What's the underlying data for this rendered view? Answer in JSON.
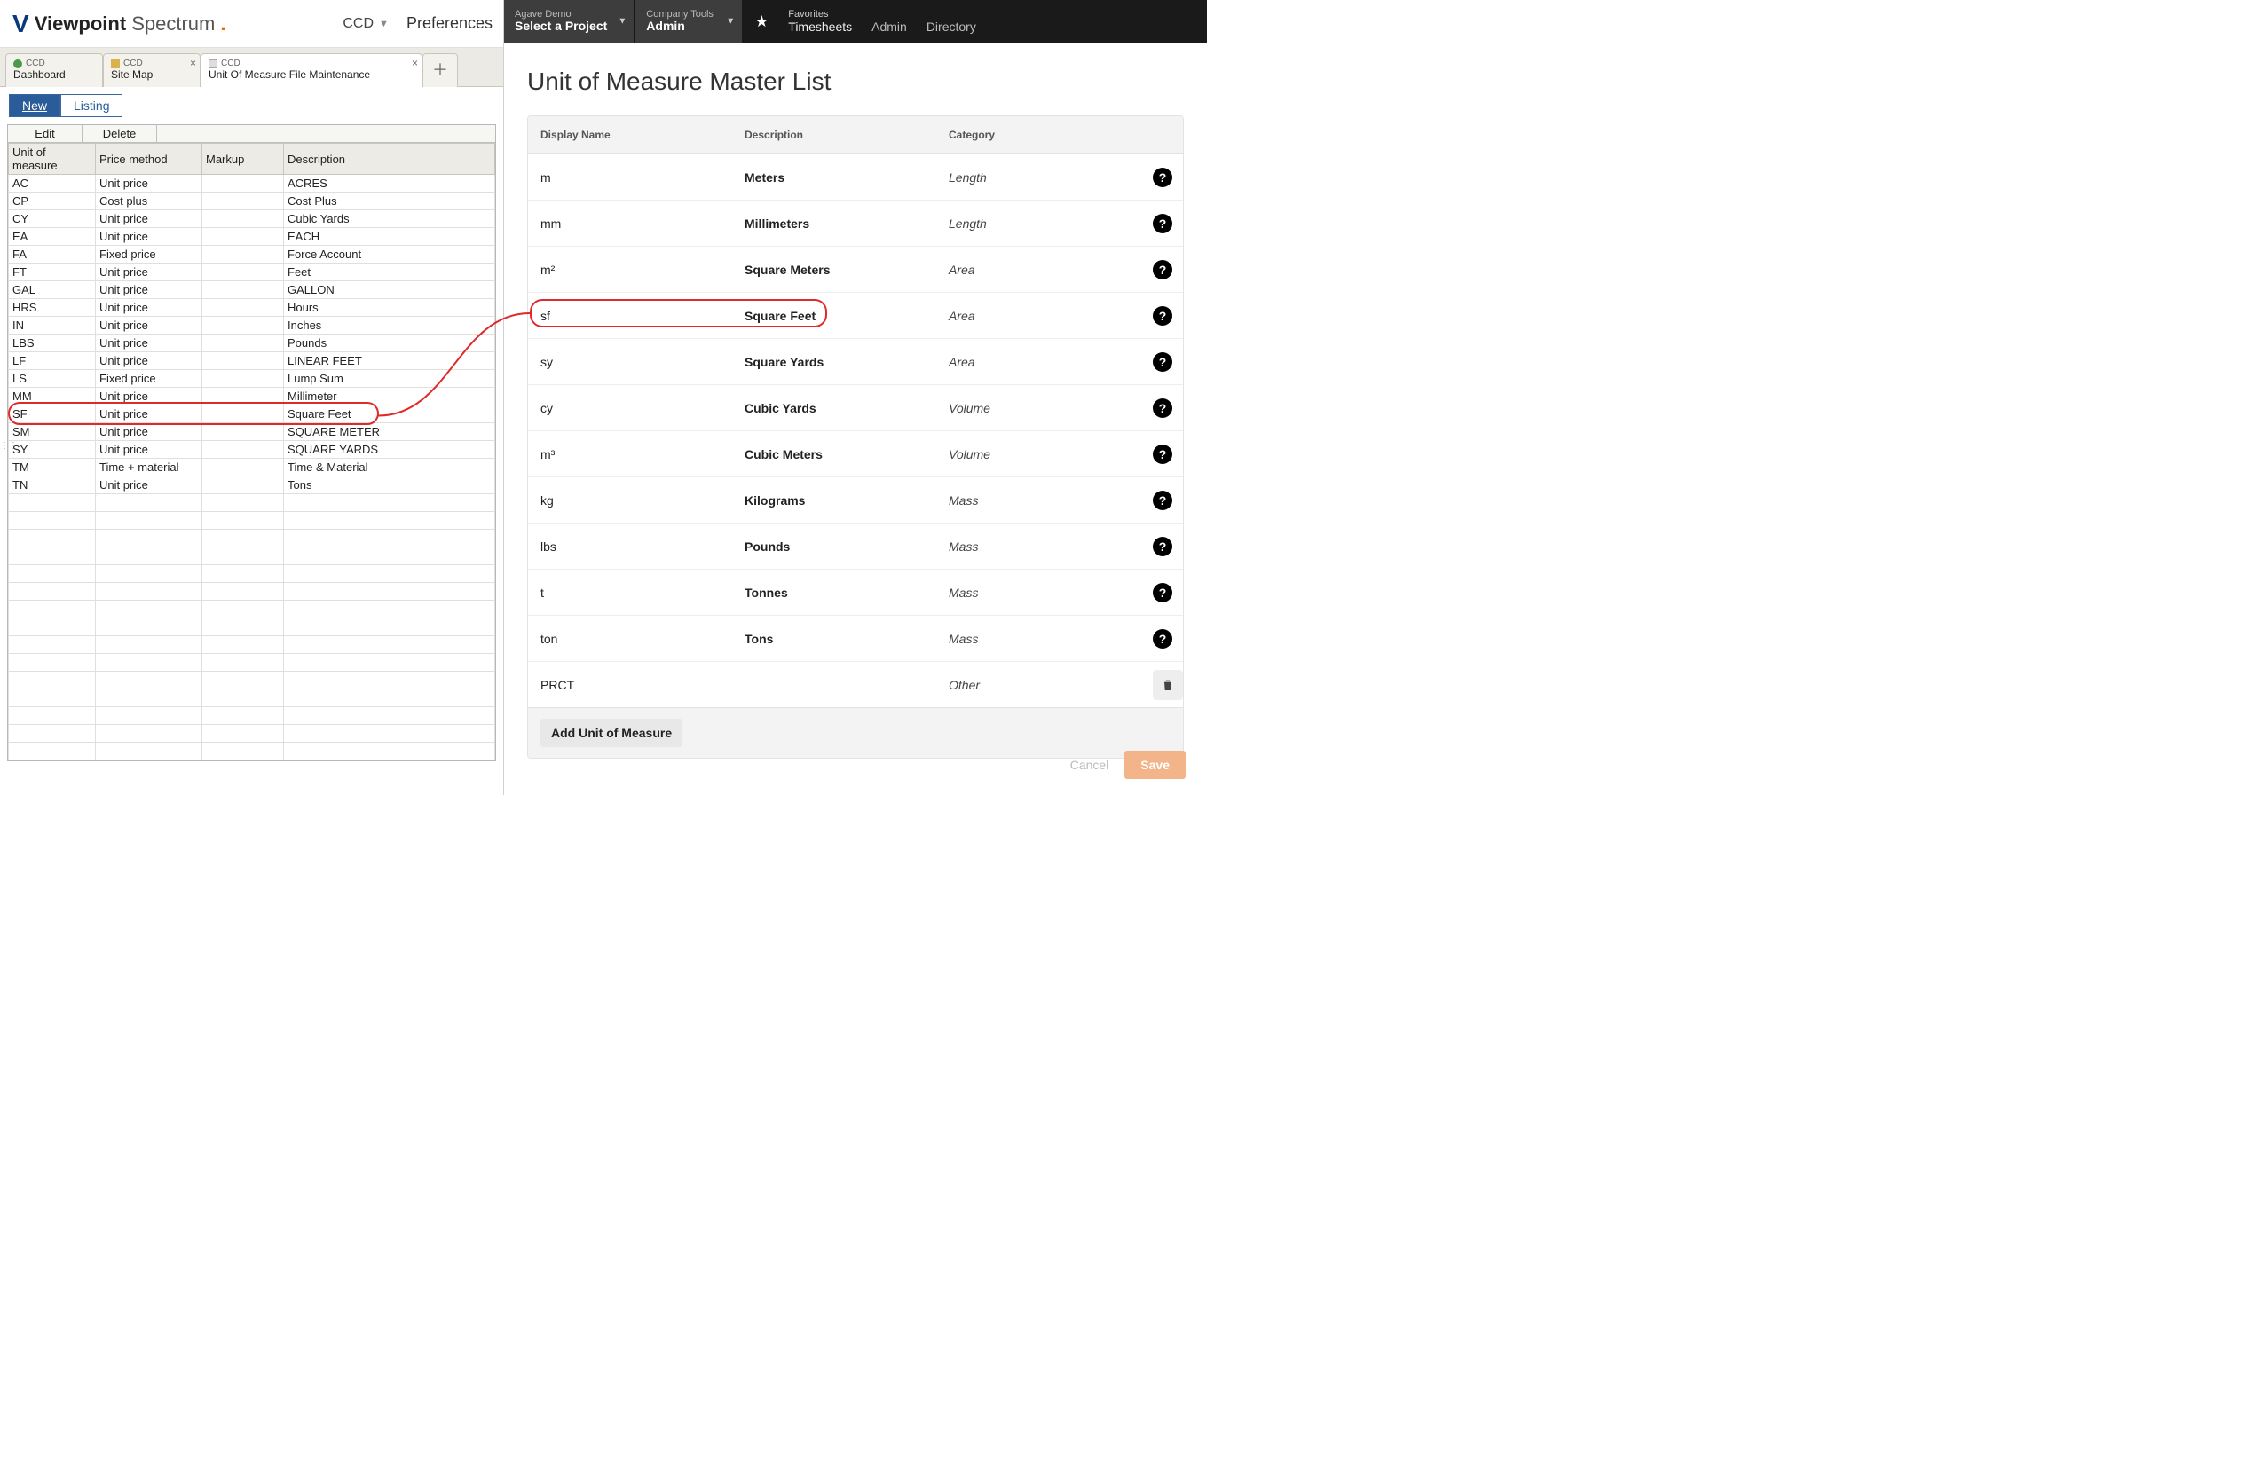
{
  "left": {
    "logo": {
      "bold": "Viewpoint",
      "light": "Spectrum",
      "dot": "."
    },
    "company_code": "CCD",
    "preferences_label": "Preferences",
    "tabs": [
      {
        "top": "CCD",
        "bottom": "Dashboard",
        "closable": false,
        "icon": "globe-icon"
      },
      {
        "top": "CCD",
        "bottom": "Site Map",
        "closable": true,
        "icon": "folder-icon"
      },
      {
        "top": "CCD",
        "bottom": "Unit Of Measure File Maintenance",
        "closable": true,
        "icon": "document-icon"
      }
    ],
    "view_switch": {
      "new": "New",
      "listing": "Listing"
    },
    "grid_toolbar": {
      "edit": "Edit",
      "delete": "Delete"
    },
    "grid_headers": {
      "uom": "Unit of measure",
      "price": "Price method",
      "markup": "Markup",
      "desc": "Description"
    },
    "rows": [
      {
        "uom": "AC",
        "price": "Unit price",
        "markup": "",
        "desc": "ACRES"
      },
      {
        "uom": "CP",
        "price": "Cost plus",
        "markup": "",
        "desc": "Cost Plus"
      },
      {
        "uom": "CY",
        "price": "Unit price",
        "markup": "",
        "desc": "Cubic Yards"
      },
      {
        "uom": "EA",
        "price": "Unit price",
        "markup": "",
        "desc": "EACH"
      },
      {
        "uom": "FA",
        "price": "Fixed price",
        "markup": "",
        "desc": "Force Account"
      },
      {
        "uom": "FT",
        "price": "Unit price",
        "markup": "",
        "desc": "Feet"
      },
      {
        "uom": "GAL",
        "price": "Unit price",
        "markup": "",
        "desc": "GALLON"
      },
      {
        "uom": "HRS",
        "price": "Unit price",
        "markup": "",
        "desc": "Hours"
      },
      {
        "uom": "IN",
        "price": "Unit price",
        "markup": "",
        "desc": "Inches"
      },
      {
        "uom": "LBS",
        "price": "Unit price",
        "markup": "",
        "desc": "Pounds"
      },
      {
        "uom": "LF",
        "price": "Unit price",
        "markup": "",
        "desc": "LINEAR FEET"
      },
      {
        "uom": "LS",
        "price": "Fixed price",
        "markup": "",
        "desc": "Lump Sum"
      },
      {
        "uom": "MM",
        "price": "Unit price",
        "markup": "",
        "desc": "Millimeter"
      },
      {
        "uom": "SF",
        "price": "Unit price",
        "markup": "",
        "desc": "Square Feet"
      },
      {
        "uom": "SM",
        "price": "Unit price",
        "markup": "",
        "desc": "SQUARE METER"
      },
      {
        "uom": "SY",
        "price": "Unit price",
        "markup": "",
        "desc": "SQUARE YARDS"
      },
      {
        "uom": "TM",
        "price": "Time + material",
        "markup": "",
        "desc": "Time & Material"
      },
      {
        "uom": "TN",
        "price": "Unit price",
        "markup": "",
        "desc": "Tons"
      }
    ],
    "highlight_row_index": 13,
    "blank_rows": 15
  },
  "right": {
    "nav": {
      "project": {
        "top": "Agave Demo",
        "bottom": "Select a Project"
      },
      "tools": {
        "top": "Company Tools",
        "bottom": "Admin"
      },
      "favorites_label": "Favorites",
      "links": [
        "Timesheets",
        "Admin",
        "Directory"
      ]
    },
    "title": "Unit of Measure Master List",
    "headers": {
      "display": "Display Name",
      "desc": "Description",
      "cat": "Category"
    },
    "rows": [
      {
        "display": "m",
        "desc": "Meters",
        "cat": "Length",
        "action": "help"
      },
      {
        "display": "mm",
        "desc": "Millimeters",
        "cat": "Length",
        "action": "help"
      },
      {
        "display": "m²",
        "desc": "Square Meters",
        "cat": "Area",
        "action": "help"
      },
      {
        "display": "sf",
        "desc": "Square Feet",
        "cat": "Area",
        "action": "help"
      },
      {
        "display": "sy",
        "desc": "Square Yards",
        "cat": "Area",
        "action": "help"
      },
      {
        "display": "cy",
        "desc": "Cubic Yards",
        "cat": "Volume",
        "action": "help"
      },
      {
        "display": "m³",
        "desc": "Cubic Meters",
        "cat": "Volume",
        "action": "help"
      },
      {
        "display": "kg",
        "desc": "Kilograms",
        "cat": "Mass",
        "action": "help"
      },
      {
        "display": "lbs",
        "desc": "Pounds",
        "cat": "Mass",
        "action": "help"
      },
      {
        "display": "t",
        "desc": "Tonnes",
        "cat": "Mass",
        "action": "help"
      },
      {
        "display": "ton",
        "desc": "Tons",
        "cat": "Mass",
        "action": "help"
      },
      {
        "display": "PRCT",
        "desc": "",
        "cat": "Other",
        "action": "trash"
      }
    ],
    "highlight_row_index": 3,
    "add_label": "Add Unit of Measure",
    "cancel_label": "Cancel",
    "save_label": "Save"
  }
}
